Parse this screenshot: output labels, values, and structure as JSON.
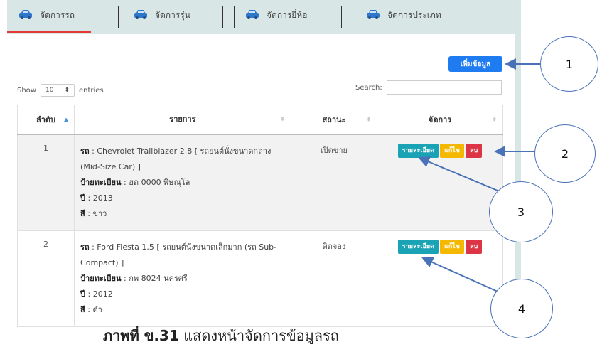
{
  "tabs": [
    {
      "label": "จัดการรถ",
      "icon": "car-icon",
      "active": true
    },
    {
      "label": "จัดการรุ่น",
      "icon": "car-icon",
      "active": false
    },
    {
      "label": "จัดการยี่ห้อ",
      "icon": "car-icon",
      "active": false
    },
    {
      "label": "จัดการประเภท",
      "icon": "car-icon",
      "active": false
    }
  ],
  "toolbar": {
    "add_label": "เพิ่มข้อมูล"
  },
  "length_menu": {
    "show_label": "Show",
    "value": "10",
    "entries_label": "entries"
  },
  "search": {
    "label": "Search:",
    "value": ""
  },
  "table": {
    "headers": [
      "ลำดับ",
      "รายการ",
      "สถานะ",
      "จัดการ"
    ],
    "rows": [
      {
        "index": "1",
        "car_label": "รถ",
        "car_value": " : Chevrolet Trailblazer 2.8 [ รถยนต์นั่งขนาดกลาง (Mid-Size Car) ]",
        "plate_label": "ป้ายทะเบียน",
        "plate_value": " : ฮต 0000 พิษณุโล",
        "year_label": "ปี",
        "year_value": " : 2013",
        "color_label": "สี",
        "color_value": " : ขาว",
        "status": "เปิดขาย"
      },
      {
        "index": "2",
        "car_label": "รถ",
        "car_value": " : Ford Fiesta 1.5 [ รถยนต์นั่งขนาดเล็กมาก (รถ Sub-Compact) ]",
        "plate_label": "ป้ายทะเบียน",
        "plate_value": " : กพ 8024 นครศรี",
        "year_label": "ปี",
        "year_value": " : 2012",
        "color_label": "สี",
        "color_value": " : ดำ",
        "status": "ติดจอง"
      }
    ],
    "actions": {
      "detail": "รายละเอียด",
      "edit": "แก้ไข",
      "delete": "ลบ"
    }
  },
  "callouts": [
    "1",
    "2",
    "3",
    "4"
  ],
  "caption": {
    "bold": "ภาพที่ ข.31",
    "text": " แสดงหน้าจัดการข้อมูลรถ"
  },
  "colors": {
    "tab_bg": "#d9e6e6",
    "active_tab_underline": "#e53935",
    "add_button": "#1e7bf0",
    "detail": "#1aa3b5",
    "edit": "#f5b800",
    "delete": "#dc3545",
    "callout_border": "#4a72b8"
  }
}
